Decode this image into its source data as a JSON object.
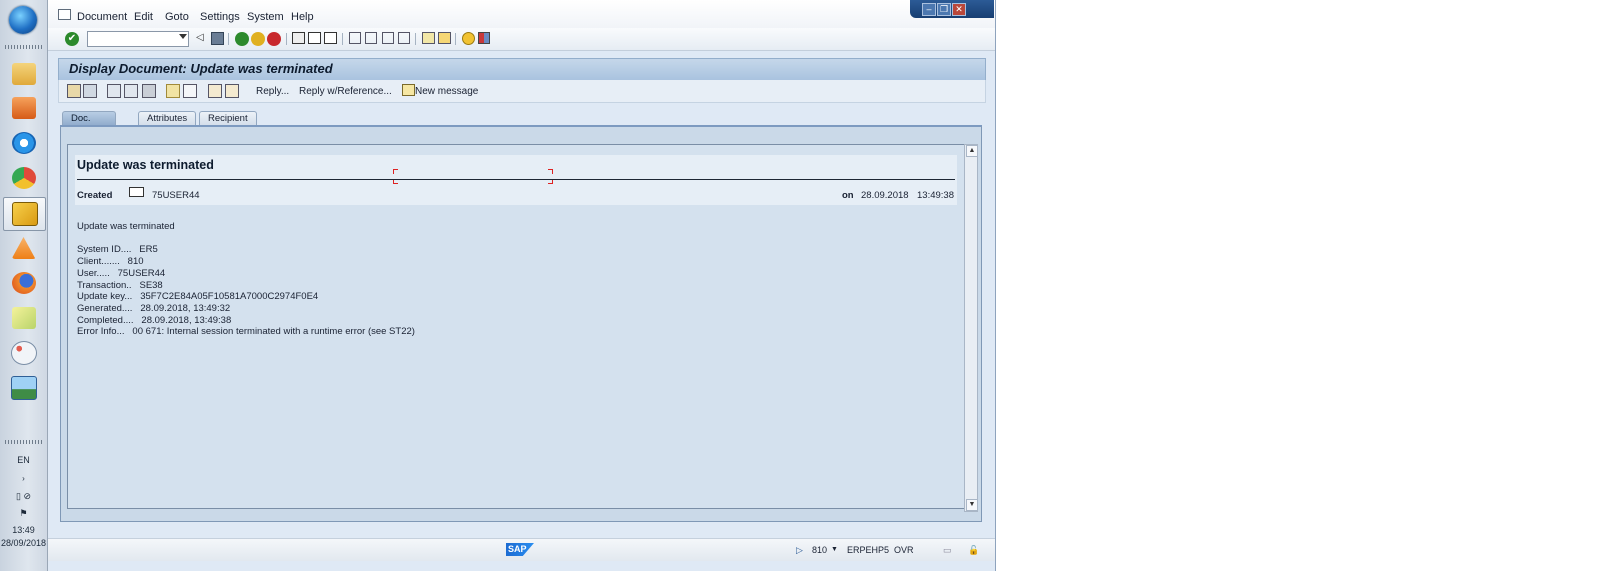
{
  "taskbar": {
    "language": "EN",
    "time": "13:49",
    "date": "28/09/2018",
    "apps": [
      {
        "name": "file-explorer-icon",
        "color": "#e9b949"
      },
      {
        "name": "media-player-icon",
        "color": "#e2742b"
      },
      {
        "name": "internet-explorer-icon",
        "color": "#1e87d6"
      },
      {
        "name": "chrome-icon",
        "color": "#e04a3a"
      },
      {
        "name": "sap-logon-icon",
        "color": "#e6b220"
      },
      {
        "name": "vlc-icon",
        "color": "#f08a1c"
      },
      {
        "name": "firefox-icon",
        "color": "#e46a1f"
      },
      {
        "name": "sticky-notes-icon",
        "color": "#cfe07a"
      },
      {
        "name": "paint-icon",
        "color": "#7db3e5"
      },
      {
        "name": "photo-viewer-icon",
        "color": "#3a7cc6"
      }
    ]
  },
  "menubar": {
    "items": [
      "Document",
      "Edit",
      "Goto",
      "Settings",
      "System",
      "Help"
    ]
  },
  "title": "Display Document: Update was terminated",
  "app_toolbar": {
    "reply": "Reply...",
    "reply_ref": "Reply w/Reference...",
    "new_message": "New message"
  },
  "tabs": [
    "Doc. contents",
    "Attributes",
    "Recipient list"
  ],
  "document": {
    "heading": "Update was terminated",
    "created_label": "Created",
    "created_by": "75USER44",
    "on_label": "on",
    "date": "28.09.2018",
    "time": "13:49:38",
    "body": [
      "Update was terminated",
      "",
      "System ID....   ER5",
      "Client.......   810",
      "User.....   75USER44",
      "Transaction..   SE38",
      "Update key...   35F7C2E84A05F10581A7000C2974F0E4",
      "Generated....   28.09.2018, 13:49:32",
      "Completed....   28.09.2018, 13:49:38",
      "Error Info...   00 671: Internal session terminated with a runtime error (see ST22)"
    ]
  },
  "statusbar": {
    "logo": "SAP",
    "client": "810",
    "server": "ERPEHP5",
    "mode": "OVR"
  }
}
